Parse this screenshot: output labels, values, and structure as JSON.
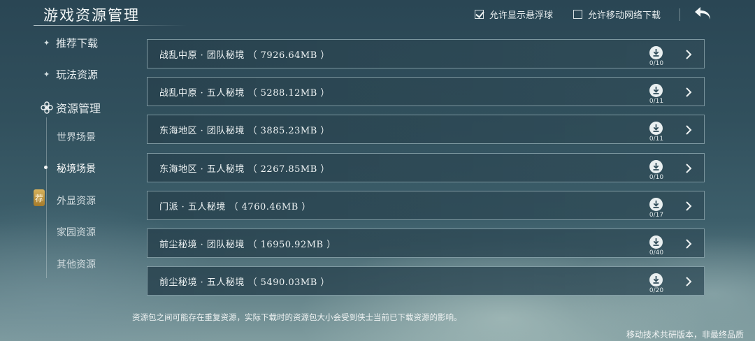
{
  "header": {
    "title": "游戏资源管理",
    "options": [
      {
        "label": "允许显示悬浮球",
        "checked": true
      },
      {
        "label": "允许移动网络下载",
        "checked": false
      }
    ]
  },
  "sidebar": {
    "items": [
      {
        "label": "推荐下载"
      },
      {
        "label": "玩法资源"
      },
      {
        "label": "资源管理"
      }
    ],
    "subitems": [
      {
        "label": "世界场景"
      },
      {
        "label": "秘境场景"
      },
      {
        "label": "外显资源"
      },
      {
        "label": "家园资源"
      },
      {
        "label": "其他资源"
      }
    ],
    "badge": "荐"
  },
  "resources": [
    {
      "name": "战乱中原 · 团队秘境 （ 7926.64MB ）",
      "count": "0/10"
    },
    {
      "name": "战乱中原 · 五人秘境 （ 5288.12MB ）",
      "count": "0/11"
    },
    {
      "name": "东海地区 · 团队秘境 （ 3885.23MB ）",
      "count": "0/11"
    },
    {
      "name": "东海地区 · 五人秘境 （ 2267.85MB ）",
      "count": "0/10"
    },
    {
      "name": "门派 · 五人秘境 （ 4760.46MB ）",
      "count": "0/17"
    },
    {
      "name": "前尘秘境 · 团队秘境 （ 16950.92MB ）",
      "count": "0/40"
    },
    {
      "name": "前尘秘境 · 五人秘境 （ 5490.03MB ）",
      "count": "0/20"
    }
  ],
  "note": "资源包之间可能存在重复资源，实际下载时的资源包大小会受到侠士当前已下载资源的影响。",
  "footer": "移动技术共研版本，非最终品质"
}
